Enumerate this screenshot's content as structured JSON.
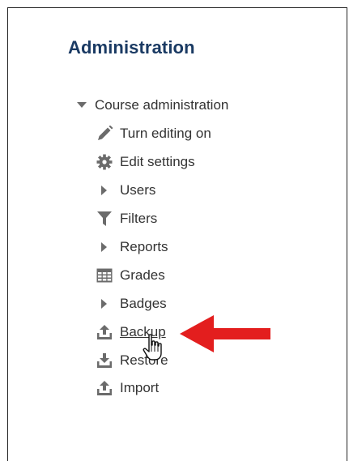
{
  "panel": {
    "title": "Administration"
  },
  "tree": {
    "root": {
      "label": "Course administration",
      "icon": "caret-down-icon",
      "expanded": true
    },
    "items": [
      {
        "label": "Turn editing on",
        "icon": "pencil-icon"
      },
      {
        "label": "Edit settings",
        "icon": "gear-icon"
      },
      {
        "label": "Users",
        "icon": "caret-right-icon"
      },
      {
        "label": "Filters",
        "icon": "filter-icon"
      },
      {
        "label": "Reports",
        "icon": "caret-right-icon"
      },
      {
        "label": "Grades",
        "icon": "table-icon"
      },
      {
        "label": "Badges",
        "icon": "caret-right-icon"
      },
      {
        "label": "Backup",
        "icon": "upload-icon",
        "hovered": true
      },
      {
        "label": "Restore",
        "icon": "download-icon"
      },
      {
        "label": "Import",
        "icon": "upload-icon"
      }
    ]
  },
  "annotation": {
    "arrow_color": "#e31e1e",
    "arrow_icon": "left-arrow-icon",
    "cursor_icon": "hand-pointer-icon"
  },
  "colors": {
    "title": "#1a3a63",
    "text": "#333333",
    "icon": "#6b6b6b"
  }
}
